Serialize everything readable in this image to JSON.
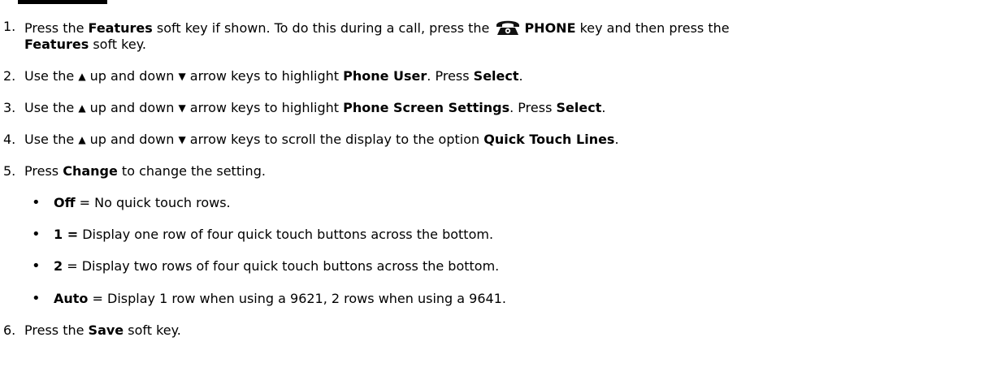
{
  "steps": [
    {
      "num": "1.",
      "parts": [
        "Press the ",
        "Features",
        " soft key if shown. To do this during a call, press the ",
        "PHONE",
        " key and then press the"
      ],
      "cont_bold": "Features",
      "cont_tail": " soft key.",
      "icon": "phone-icon"
    },
    {
      "num": "2.",
      "a": "Use the ",
      "b": " up and down ",
      "c": " arrow keys to highlight ",
      "bold": "Phone User",
      "d": ". Press ",
      "bold2": "Select",
      "e": "."
    },
    {
      "num": "3.",
      "a": "Use the ",
      "b": " up and down ",
      "c": " arrow keys to highlight ",
      "bold": "Phone Screen Settings",
      "d": ". Press ",
      "bold2": "Select",
      "e": "."
    },
    {
      "num": "4.",
      "a": "Use the ",
      "b": " up and down ",
      "c": " arrow keys to scroll the display to the option ",
      "bold": "Quick Touch Lines",
      "d": "."
    },
    {
      "num": "5.",
      "a": "Press ",
      "bold": "Change",
      "b": " to change the setting."
    },
    {
      "num": "6.",
      "a": "Press the ",
      "bold": "Save",
      "b": " soft key."
    }
  ],
  "arrows": {
    "up": "▲",
    "down": "▼"
  },
  "bullets": [
    {
      "bold": "Off",
      "text": " = No quick touch rows."
    },
    {
      "bold": "1 =",
      "text": " Display one row of four quick touch buttons across the bottom."
    },
    {
      "bold": "2",
      "text": " = Display two rows of four quick touch buttons across the bottom."
    },
    {
      "bold": "Auto",
      "text": " = Display 1 row when using a 9621, 2 rows when using a 9641."
    }
  ],
  "bullet_glyph": "•"
}
